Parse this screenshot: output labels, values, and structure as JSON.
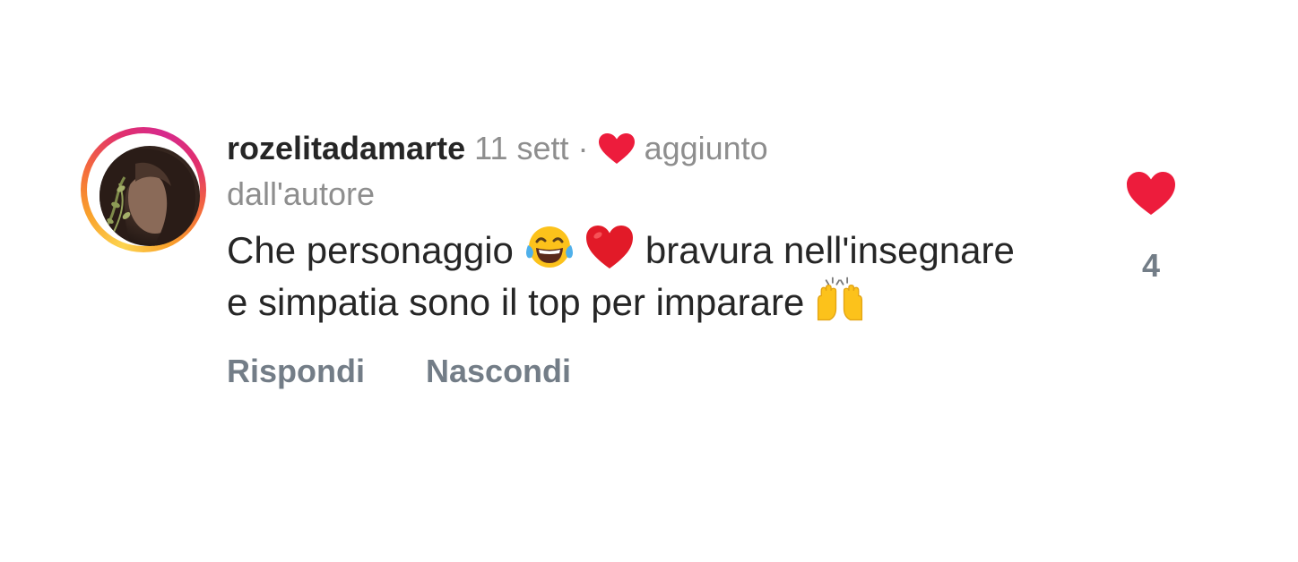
{
  "comment": {
    "username": "rozelitadamarte",
    "timestamp": "11 sett",
    "separator": "·",
    "author_like_text_1": "aggiunto",
    "author_like_text_2": "dall'autore",
    "text_part_1": "Che personaggio ",
    "text_part_2": " bravura nell'insegnare e simpatia sono il top per imparare ",
    "emojis": [
      "face-with-tears-of-joy-icon",
      "red-heart-icon",
      "raising-hands-icon"
    ],
    "actions": {
      "reply": "Rispondi",
      "hide": "Nascondi"
    },
    "like_count": "4",
    "colors": {
      "heart": "#ed1c3c",
      "text": "#262626",
      "secondary": "#8e8e8e",
      "action": "#737d87"
    }
  }
}
